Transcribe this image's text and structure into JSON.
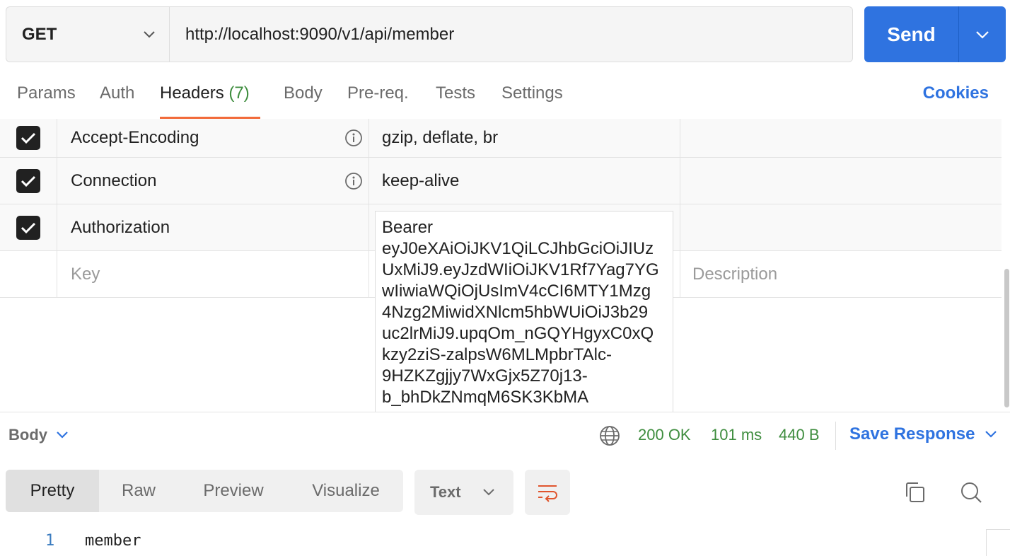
{
  "request": {
    "method": "GET",
    "url": "http://localhost:9090/v1/api/member",
    "send_label": "Send"
  },
  "tabs": [
    {
      "label": "Params"
    },
    {
      "label": "Auth"
    },
    {
      "label": "Headers",
      "count": "(7)",
      "active": true
    },
    {
      "label": "Body"
    },
    {
      "label": "Pre-req."
    },
    {
      "label": "Tests"
    },
    {
      "label": "Settings"
    }
  ],
  "cookies_label": "Cookies",
  "headers": {
    "rows": [
      {
        "key": "Accept-Encoding",
        "value": "gzip, deflate, br",
        "checked": true
      },
      {
        "key": "Connection",
        "value": "keep-alive",
        "checked": true
      },
      {
        "key": "Authorization",
        "value": "Bearer eyJ0eXAiOiJKV1QiLCJhbGciOiJIUzUxMiJ9.eyJzdWIiOiJKV1Rf7Yag7YGwIiwiaWQiOjUsImV4cCI6MTY1Mzg4Nzg2MiwidXNlcm5hbWUiOiJ3b29uc2lrMiJ9.upqOm_nGQYHgyxC0xQkzy2ziS-zalpsW6MLMpbrTAlc-9HZKZgjjy7WxGjx5Z70j13-b_bhDkZNmqM6SK3KbMA",
        "checked": true
      }
    ],
    "bearer_lines": [
      "Bearer",
      "eyJ0eXAiOiJKV1QiLCJhbGciOiJIUz",
      "UxMiJ9.eyJzdWIiOiJKV1Rf7Yag7YG",
      "wIiwiaWQiOjUsImV4cCI6MTY1Mzg",
      "4Nzg2MiwidXNlcm5hbWUiOiJ3b29",
      "uc2lrMiJ9.upqOm_nGQYHgyxC0xQ",
      "kzy2ziS-zalpsW6MLMpbrTAlc-",
      "9HZKZgjjy7WxGjx5Z70j13-",
      "b_bhDkZNmqM6SK3KbMA"
    ],
    "key_placeholder": "Key",
    "description_placeholder": "Description"
  },
  "response": {
    "section_label": "Body",
    "status": "200 OK",
    "time": "101 ms",
    "size": "440 B",
    "save_label": "Save Response",
    "views": [
      "Pretty",
      "Raw",
      "Preview",
      "Visualize"
    ],
    "active_view": "Pretty",
    "format": "Text",
    "lines": [
      {
        "no": "1",
        "text": "member"
      }
    ]
  },
  "colors": {
    "accent": "#2f73e0",
    "tab_underline": "#f26b3a",
    "status_ok": "#3e8d3e"
  }
}
